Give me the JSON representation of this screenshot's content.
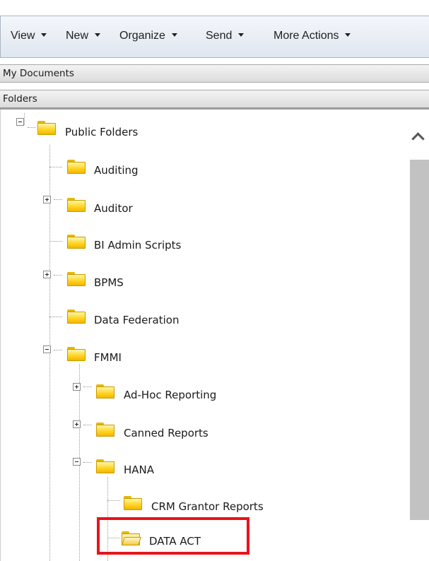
{
  "toolbar": {
    "items": [
      {
        "label": "View",
        "has_arrow": true
      },
      {
        "label": "New",
        "has_arrow": true
      },
      {
        "label": "Organize",
        "has_arrow": true
      },
      {
        "label": "Send",
        "has_arrow": true
      },
      {
        "label": "More Actions",
        "has_arrow": true
      }
    ]
  },
  "sections": {
    "my_documents": "My Documents",
    "folders": "Folders"
  },
  "tree": {
    "root": {
      "label": "Public Folders",
      "state": "expanded",
      "icon": "folder-icon"
    },
    "items": [
      {
        "label": "Auditing",
        "state": "leaf",
        "icon": "folder-icon"
      },
      {
        "label": "Auditor",
        "state": "collapsed",
        "icon": "folder-icon"
      },
      {
        "label": "BI Admin Scripts",
        "state": "leaf",
        "icon": "folder-icon"
      },
      {
        "label": "BPMS",
        "state": "collapsed",
        "icon": "folder-icon"
      },
      {
        "label": "Data Federation",
        "state": "leaf",
        "icon": "folder-icon"
      },
      {
        "label": "FMMI",
        "state": "expanded",
        "icon": "folder-icon"
      },
      {
        "label": "Ad-Hoc Reporting",
        "state": "collapsed",
        "icon": "folder-icon"
      },
      {
        "label": "Canned Reports",
        "state": "collapsed",
        "icon": "folder-icon"
      },
      {
        "label": "HANA",
        "state": "expanded",
        "icon": "folder-icon"
      },
      {
        "label": "CRM Grantor Reports",
        "state": "leaf",
        "icon": "folder-icon"
      },
      {
        "label": "DATA ACT",
        "state": "leaf",
        "icon": "folder-open-icon",
        "selected": true
      }
    ]
  },
  "colors": {
    "highlight": "#e8141b",
    "folder": "#ffd21c",
    "scrollbar": "#c2c2c2"
  }
}
